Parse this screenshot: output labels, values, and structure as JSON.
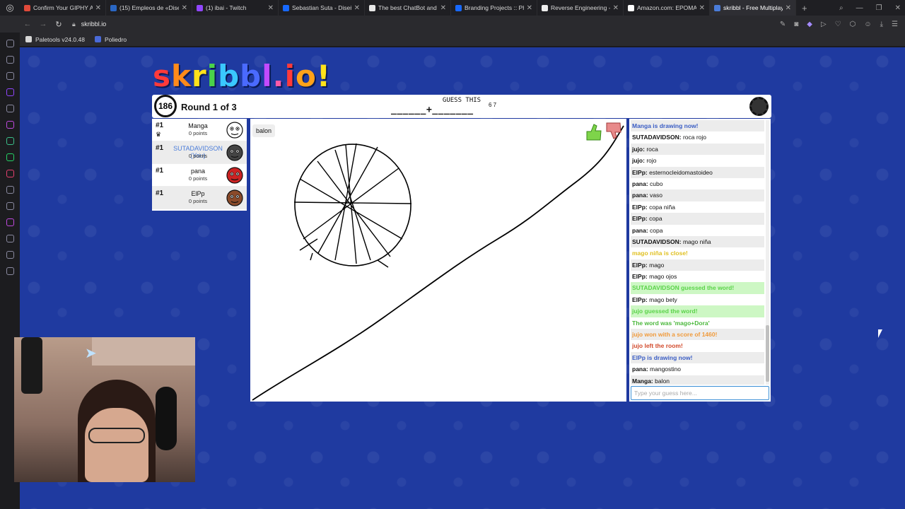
{
  "browser": {
    "tabs": [
      {
        "label": "Confirm Your GIPHY Ac",
        "color": "#e04a3a"
      },
      {
        "label": "(15) Empleos de «Diseñ",
        "color": "#2a67c4"
      },
      {
        "label": "(1) ibai - Twitch",
        "color": "#9146ff"
      },
      {
        "label": "Sebastian Suta - Diseñ",
        "color": "#1769ff"
      },
      {
        "label": "The best ChatBot and W",
        "color": "#e8e8e8"
      },
      {
        "label": "Branding Projects :: Pho",
        "color": "#1769ff"
      },
      {
        "label": "Reverse Engineering - Se",
        "color": "#eeeeee"
      },
      {
        "label": "Amazon.com: EPOMAKE",
        "color": "#ffffff"
      },
      {
        "label": "skribbl - Free Multiplaye",
        "color": "#4a7cd9",
        "active": true
      }
    ],
    "url": "skribbl.io",
    "bookmarks": [
      {
        "label": "Paletools v24.0.48",
        "color": "#d8d8d8"
      },
      {
        "label": "Poliedro",
        "color": "#4a6ad8"
      }
    ]
  },
  "game": {
    "logo": {
      "letters": [
        "s",
        "k",
        "r",
        "i",
        "b",
        "b",
        "l",
        ".",
        "i",
        "o",
        "!"
      ],
      "colors": [
        "#ff3a3a",
        "#ff8a1a",
        "#ffe21a",
        "#4ad24a",
        "#3ac8ff",
        "#4a6aff",
        "#c24aff",
        "#ff5aa8",
        "#ff3a3a",
        "#ffa21a",
        "#ffe21a"
      ]
    },
    "timer": "186",
    "round": "Round 1 of 3",
    "guess_label": "GUESS THIS",
    "word_hint": "______+_______",
    "word_lengths": "6 7",
    "players": [
      {
        "rank": "#1",
        "name": "Manga",
        "points": "0 points",
        "you": false,
        "avatar_color": "#ffffff"
      },
      {
        "rank": "#1",
        "name": "SUTADAVIDSON (You)",
        "points": "0 points",
        "you": true,
        "avatar_color": "#444444"
      },
      {
        "rank": "#1",
        "name": "pana",
        "points": "0 points",
        "you": false,
        "avatar_color": "#cc2222"
      },
      {
        "rank": "#1",
        "name": "ElPp",
        "points": "0 points",
        "you": false,
        "avatar_color": "#8a4a2a"
      }
    ],
    "last_guess": "balon",
    "chat": [
      {
        "type": "draw",
        "text": "Manga is drawing now!"
      },
      {
        "type": "msg",
        "user": "SUTADAVIDSON:",
        "text": "roca rojo"
      },
      {
        "type": "msg",
        "user": "jujo:",
        "text": "roca"
      },
      {
        "type": "msg",
        "user": "jujo:",
        "text": "rojo"
      },
      {
        "type": "msg",
        "user": "ElPp:",
        "text": "esternocleidomastoideo"
      },
      {
        "type": "msg",
        "user": "pana:",
        "text": "cubo"
      },
      {
        "type": "msg",
        "user": "pana:",
        "text": "vaso"
      },
      {
        "type": "msg",
        "user": "ElPp:",
        "text": "copa niña"
      },
      {
        "type": "msg",
        "user": "ElPp:",
        "text": "copa"
      },
      {
        "type": "msg",
        "user": "pana:",
        "text": "copa"
      },
      {
        "type": "msg",
        "user": "SUTADAVIDSON:",
        "text": "mago niña"
      },
      {
        "type": "close",
        "text": "mago niña is close!"
      },
      {
        "type": "msg",
        "user": "ElPp:",
        "text": "mago"
      },
      {
        "type": "msg",
        "user": "ElPp:",
        "text": "mago ojos"
      },
      {
        "type": "guessed",
        "text": "SUTADAVIDSON guessed the word!"
      },
      {
        "type": "msg",
        "user": "ElPp:",
        "text": "mago bety"
      },
      {
        "type": "guessed",
        "text": "jujo guessed the word!"
      },
      {
        "type": "word",
        "text": "The word was 'mago+Dora'"
      },
      {
        "type": "won",
        "text": "jujo won with a score of 1460!"
      },
      {
        "type": "left",
        "text": "jujo left the room!"
      },
      {
        "type": "draw",
        "text": "ElPp is drawing now!"
      },
      {
        "type": "msg",
        "user": "pana:",
        "text": "mangostino"
      },
      {
        "type": "msg",
        "user": "Manga:",
        "text": "balon"
      }
    ],
    "chat_placeholder": "Type your guess here..."
  }
}
